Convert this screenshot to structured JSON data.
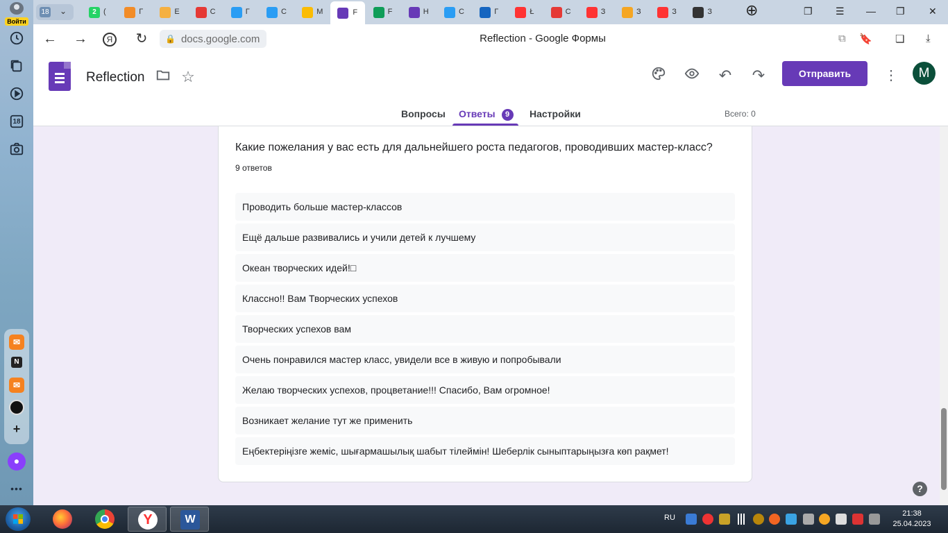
{
  "browser": {
    "profile_button": "Войти",
    "tab_group_count": "18",
    "tabs": [
      {
        "icon": "whatsapp-icon",
        "color": "#25d366",
        "label": "(",
        "badge": "2"
      },
      {
        "icon": "orange-icon",
        "color": "#f28c28",
        "label": "Г"
      },
      {
        "icon": "cat-icon",
        "color": "#f5b041",
        "label": "E"
      },
      {
        "icon": "video-icon",
        "color": "#e53935",
        "label": "С"
      },
      {
        "icon": "c-icon",
        "color": "#2a9df4",
        "label": "Г"
      },
      {
        "icon": "c-icon",
        "color": "#2a9df4",
        "label": "С"
      },
      {
        "icon": "drive-icon",
        "color": "#fbbc04",
        "label": "М"
      },
      {
        "icon": "forms-icon",
        "color": "#673ab7",
        "label": "F",
        "active": true
      },
      {
        "icon": "sheets-icon",
        "color": "#0f9d58",
        "label": "F"
      },
      {
        "icon": "forms-icon",
        "color": "#673ab7",
        "label": "Н"
      },
      {
        "icon": "mail-icon",
        "color": "#2a9df4",
        "label": "С"
      },
      {
        "icon": "mail-icon",
        "color": "#1565c0",
        "label": "Г"
      },
      {
        "icon": "yandex-icon",
        "color": "#f33",
        "label": "Ł"
      },
      {
        "icon": "video-icon",
        "color": "#e53935",
        "label": "С"
      },
      {
        "icon": "yandex-icon",
        "color": "#f33",
        "label": "З"
      },
      {
        "icon": "image-icon",
        "color": "#f5a623",
        "label": "З"
      },
      {
        "icon": "yandex-icon",
        "color": "#f33",
        "label": "З"
      },
      {
        "icon": "download-icon",
        "color": "#333333",
        "label": "З"
      }
    ],
    "url": "docs.google.com",
    "page_title": "Reflection - Google Формы",
    "sidebar_calendar": "18"
  },
  "form": {
    "title": "Reflection",
    "send_label": "Отправить",
    "avatar_letter": "M",
    "tabs": {
      "questions": "Вопросы",
      "responses": "Ответы",
      "responses_badge": "9",
      "settings": "Настройки"
    },
    "total_label": "Всего: 0",
    "accent_color": "#673ab7"
  },
  "question": {
    "title": "Какие пожелания у вас есть для дальнейшего роста педагогов, проводивших мастер-класс?",
    "count": "9 ответов",
    "answers": [
      "Проводить больше мастер-классов",
      "Ещё дальше развивались и учили детей к лучшему",
      "Океан творческих идей!□",
      "Классно!! Вам Творческих успехов",
      "Творческих успехов вам",
      "Очень понравился мастер класс, увидели все в живую и попробывали",
      "Желаю творческих успехов, процветание!!! Спасибо, Вам огромное!",
      "Возникает желание тут же применить",
      "Еңбектеріңізге жеміс, шығармашылық шабыт тілеймін! Шеберлік сыныптарыңызға көп рақмет!"
    ]
  },
  "taskbar": {
    "language": "RU",
    "time": "21:38",
    "date": "25.04.2023",
    "apps": [
      "firefox-icon",
      "chrome-icon",
      "yandex-browser-icon",
      "word-icon"
    ]
  }
}
